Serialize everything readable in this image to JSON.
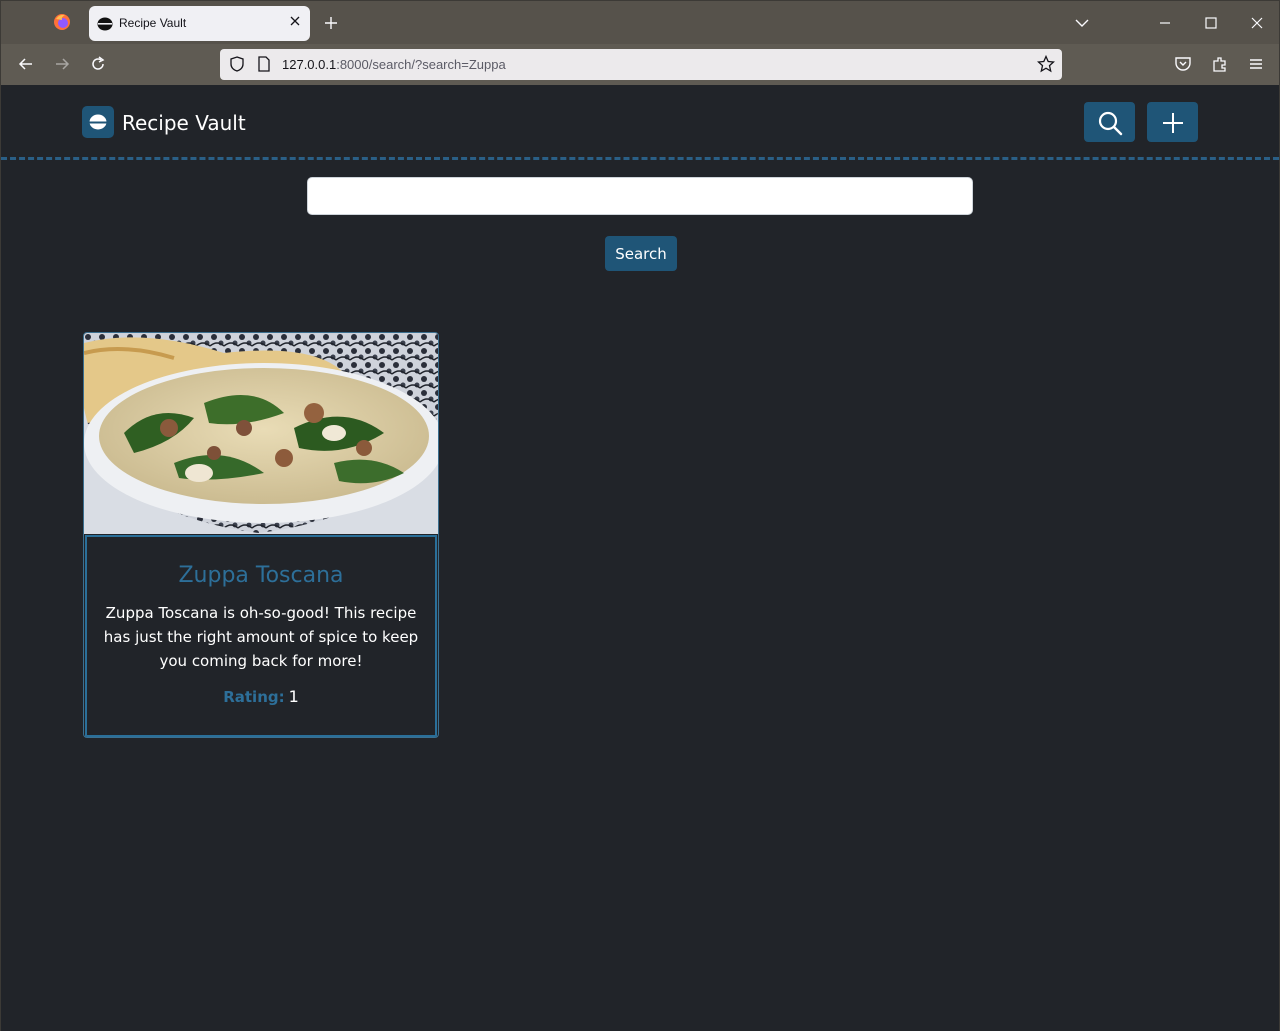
{
  "browser": {
    "tab_title": "Recipe Vault",
    "url_host": "127.0.0.1",
    "url_rest": ":8000/search/?search=Zuppa"
  },
  "site": {
    "brand": "Recipe Vault"
  },
  "search": {
    "value": "",
    "placeholder": "",
    "button_label": "Search"
  },
  "results": [
    {
      "title": "Zuppa Toscana",
      "description": "Zuppa Toscana is oh-so-good! This recipe has just the right amount of spice to keep you coming back for more!",
      "rating_label": "Rating:",
      "rating_value": "1",
      "image": "zuppa-toscana-soup-photo"
    }
  ],
  "colors": {
    "accent": "#1f5577",
    "link": "#2d6f99",
    "background": "#212429"
  }
}
